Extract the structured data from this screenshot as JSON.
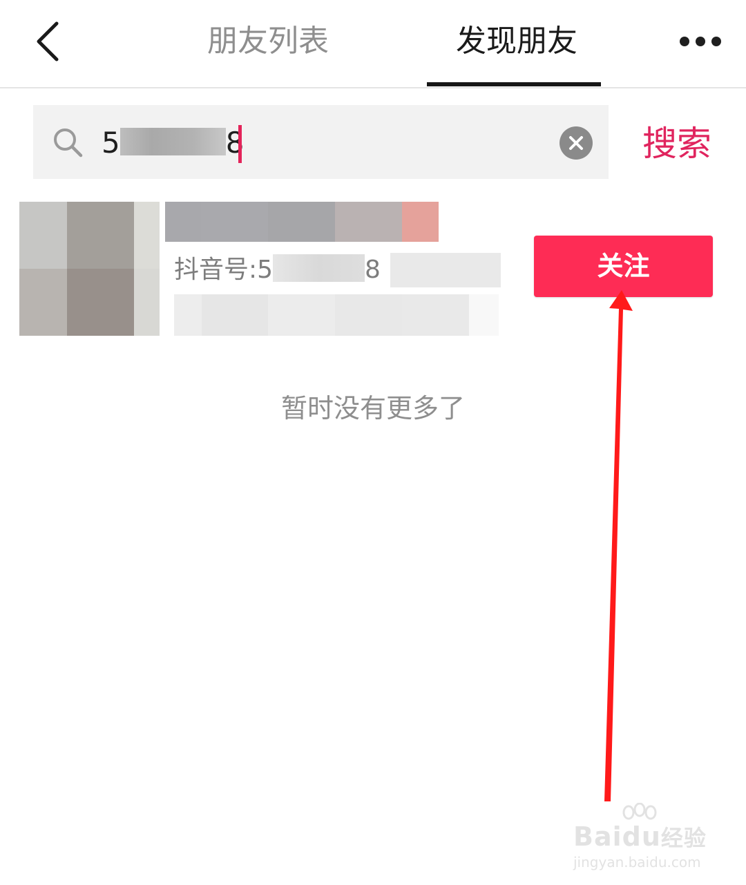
{
  "header": {
    "tabs": [
      {
        "label": "朋友列表",
        "active": false
      },
      {
        "label": "发现朋友",
        "active": true
      }
    ]
  },
  "search": {
    "query_prefix": "5",
    "query_suffix": "8",
    "submit_label": "搜索"
  },
  "results": [
    {
      "id_prefix": "抖音号:5",
      "id_suffix": "8",
      "follow_label": "关注"
    }
  ],
  "footer": {
    "no_more_text": "暂时没有更多了"
  },
  "watermark": {
    "logo": "Bai",
    "logo_mid": "du",
    "logo_suffix": "经验",
    "url": "jingyan.baidu.com"
  },
  "colors": {
    "accent": "#fe2c55",
    "search_accent": "#e0245e",
    "annotation_arrow": "#ff1a1a"
  }
}
